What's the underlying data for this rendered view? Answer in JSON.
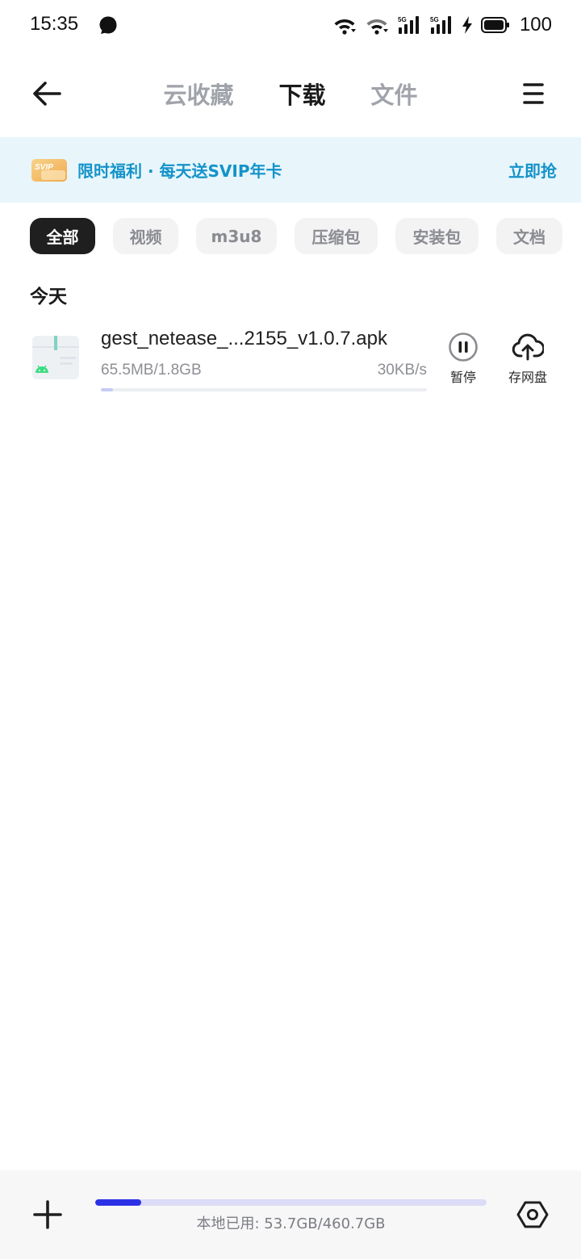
{
  "status_bar": {
    "time": "15:35",
    "battery": "100",
    "icons": [
      "chat-bubble-icon",
      "wifi-icon",
      "wifi-download-icon",
      "signal-5g-icon",
      "signal-5g-icon",
      "charging-icon",
      "battery-icon"
    ]
  },
  "header": {
    "tabs": [
      {
        "label": "云收藏",
        "active": false
      },
      {
        "label": "下载",
        "active": true
      },
      {
        "label": "文件",
        "active": false
      }
    ]
  },
  "promo": {
    "badge": "SVIP",
    "text": "限时福利 · 每天送SVIP年卡",
    "action": "立即抢"
  },
  "filters": [
    {
      "label": "全部",
      "active": true
    },
    {
      "label": "视频",
      "active": false
    },
    {
      "label": "m3u8",
      "active": false
    },
    {
      "label": "压缩包",
      "active": false
    },
    {
      "label": "安装包",
      "active": false
    },
    {
      "label": "文档",
      "active": false
    }
  ],
  "section_title": "今天",
  "downloads": [
    {
      "name": "gest_netease_...2155_v1.0.7.apk",
      "size": "65.5MB/1.8GB",
      "speed": "30KB/s",
      "progress": 0.036,
      "pause_label": "暂停",
      "cloud_label": "存网盘"
    }
  ],
  "bottom_bar": {
    "storage_label": "本地已用: 53.7GB/460.7GB",
    "storage_used_fraction": 0.117
  },
  "colors": {
    "accent_blue": "#1493c9",
    "promo_bg": "#e8f6fc",
    "storage_fill": "#2d31e6",
    "progress_fill": "#c6cbf5"
  }
}
